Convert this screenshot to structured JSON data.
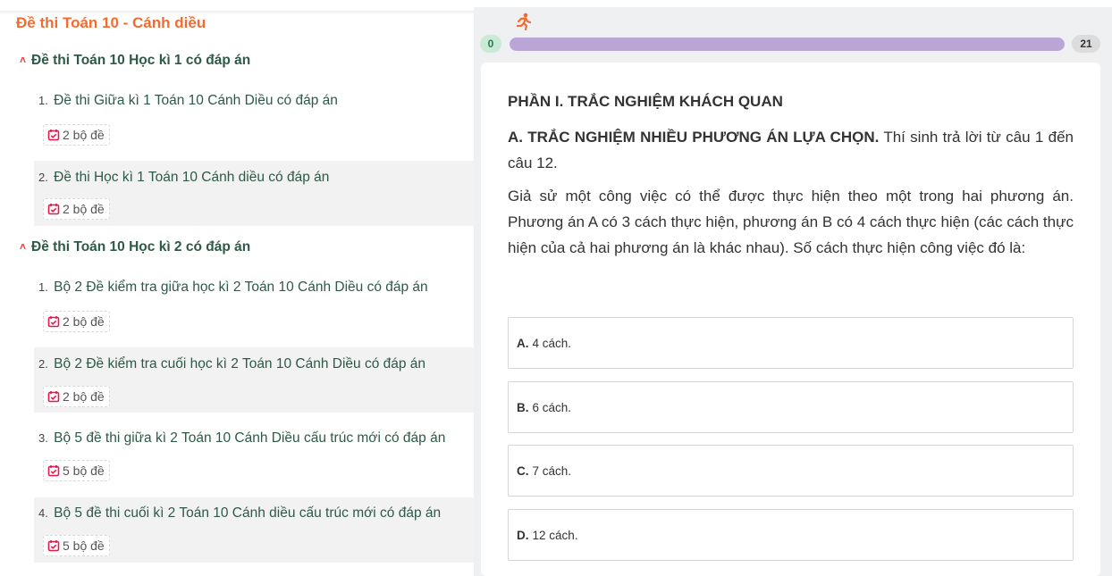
{
  "sidebar": {
    "course_title": "Đề thi Toán 10 - Cánh diều",
    "sections": [
      {
        "title": "Đề thi Toán 10 Học kì 1 có đáp án",
        "items": [
          {
            "num": "1.",
            "title": "Đề thi Giữa kì 1 Toán 10 Cánh Diều có đáp án",
            "badge": "2 bộ đề"
          },
          {
            "num": "2.",
            "title": "Đề thi Học kì 1 Toán 10 Cánh diều có đáp án",
            "badge": "2 bộ đề"
          }
        ]
      },
      {
        "title": "Đề thi Toán 10 Học kì 2 có đáp án",
        "items": [
          {
            "num": "1.",
            "title": "Bộ 2 Đề kiểm tra giữa học kì 2 Toán 10 Cánh Diều có đáp án",
            "badge": "2 bộ đề"
          },
          {
            "num": "2.",
            "title": "Bộ 2 Đề kiểm tra cuối học kì 2 Toán 10 Cánh Diều có đáp án",
            "badge": "2 bộ đề"
          },
          {
            "num": "3.",
            "title": "Bộ 5 đề thi giữa kì 2 Toán 10 Cánh Diều cấu trúc mới có đáp án",
            "badge": "5 bộ đề"
          },
          {
            "num": "4.",
            "title": "Bộ 5 đề thi cuối kì 2 Toán 10 Cánh diều cấu trúc mới có đáp án",
            "badge": "5 bộ đề"
          }
        ]
      }
    ]
  },
  "progress": {
    "start_label": "0",
    "end_label": "21",
    "fraction": 1.0,
    "fill_color": "#b9a6d6",
    "runner_icon": "running-person-icon"
  },
  "question": {
    "part_heading": "PHẦN I. TRẮC NGHIỆM KHÁCH QUAN",
    "sub_heading_bold": "A. TRẮC NGHIỆM NHIỀU PHƯƠNG ÁN LỰA CHỌN.",
    "sub_heading_rest": " Thí sinh trả lời từ câu 1 đến câu 12.",
    "text": "Giả sử một công việc có thể được thực hiện theo một trong hai phương án. Phương án A có 3 cách thực hiện, phương án B có 4 cách thực hiện (các cách thực hiện của cả hai phương án là khác nhau). Số cách thực hiện công việc đó là:",
    "options": [
      {
        "key": "A.",
        "text": "4 cách."
      },
      {
        "key": "B.",
        "text": "6 cách."
      },
      {
        "key": "C.",
        "text": "7 cách."
      },
      {
        "key": "D.",
        "text": "12 cách."
      }
    ]
  },
  "colors": {
    "accent_orange": "#f26b30",
    "heading_green": "#2d5a46",
    "badge_icon_red": "#e6194b"
  }
}
